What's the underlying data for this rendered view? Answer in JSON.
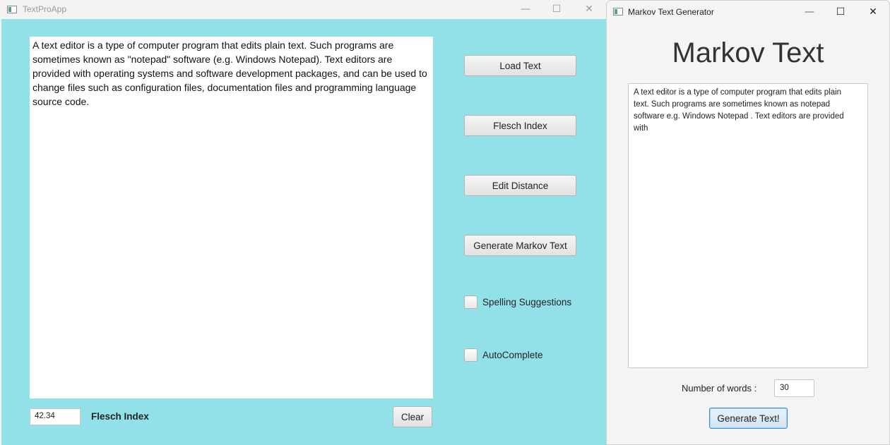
{
  "main_window": {
    "title": "TextProApp",
    "controls": {
      "minimize": "—",
      "maximize": "☐",
      "close": "✕"
    },
    "editor_text": "A text editor is a type of computer program that edits plain text. Such programs are\nsometimes known as \"notepad\" software (e.g. Windows Notepad). Text editors are\nprovided with operating systems and software development packages, and can be used to\nchange files such as configuration files, documentation files and programming language\nsource code.",
    "buttons": {
      "load_text": "Load Text",
      "flesch_index": "Flesch Index",
      "edit_distance": "Edit Distance",
      "generate_markov": "Generate Markov Text",
      "clear": "Clear"
    },
    "checkboxes": {
      "spelling": {
        "label": "Spelling Suggestions",
        "checked": false
      },
      "autocomplete": {
        "label": "AutoComplete",
        "checked": false
      }
    },
    "flesch_score": "42.34",
    "flesch_label": "Flesch Index",
    "background_color": "#92e1e8"
  },
  "markov_window": {
    "title": "Markov Text Generator",
    "controls": {
      "minimize": "—",
      "maximize": "☐",
      "close": "✕"
    },
    "heading": "Markov Text",
    "generated_text": "A text editor is a type of computer program that edits plain\ntext. Such programs are sometimes known as notepad\nsoftware e.g. Windows Notepad . Text editors are provided\nwith",
    "words_label": "Number of words :",
    "words_value": "30",
    "generate_button": "Generate Text!"
  }
}
